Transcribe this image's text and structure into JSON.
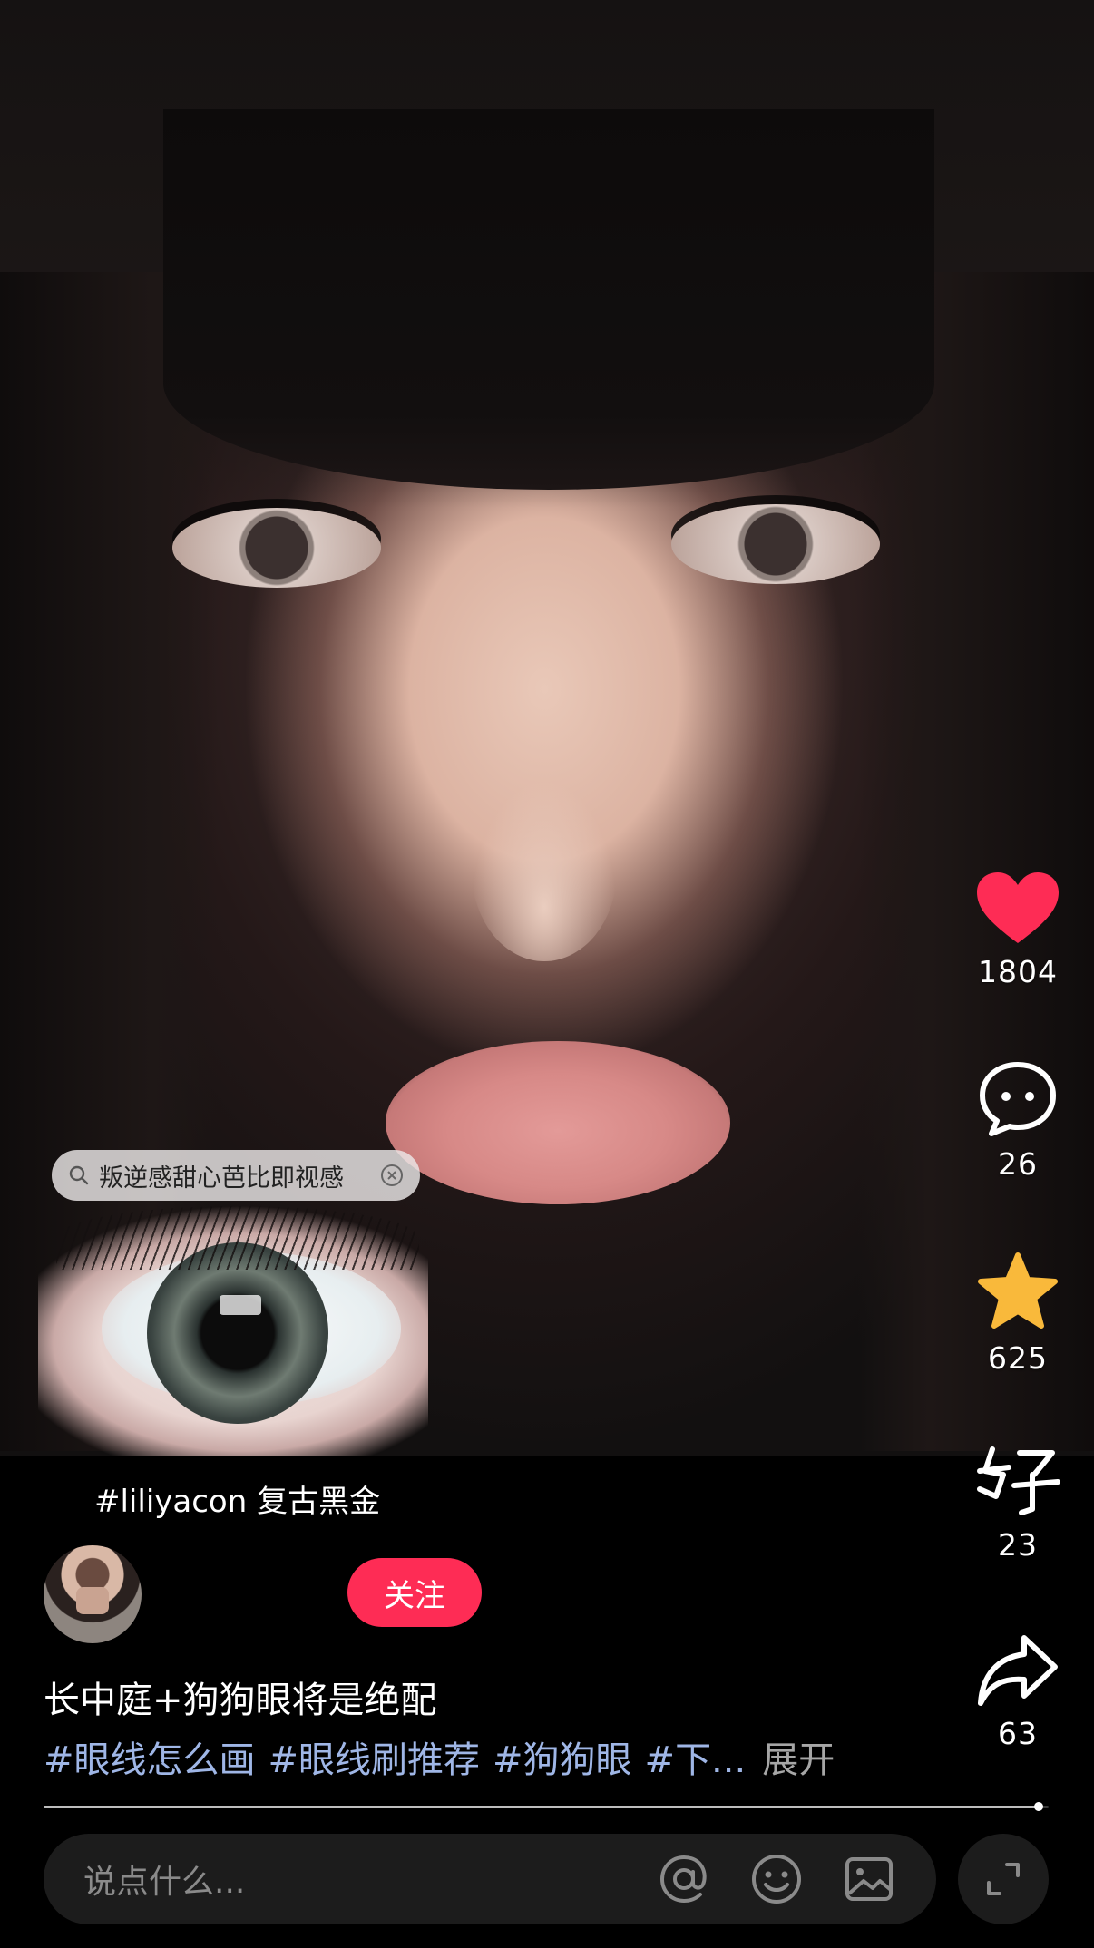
{
  "search_chip": {
    "text": "叛逆感甜心芭比即视感"
  },
  "actions": {
    "like": {
      "count": "1804",
      "color": "#fe2c55"
    },
    "comment": {
      "count": "26"
    },
    "favorite": {
      "count": "625",
      "color": "#f9b93b"
    },
    "good": {
      "count": "23"
    },
    "share": {
      "count": "63"
    }
  },
  "product_tag": "#liliyacon 复古黑金",
  "follow_label": "关注",
  "post": {
    "title": "长中庭+狗狗眼将是绝配",
    "hashtags": [
      "#眼线怎么画",
      "#眼线刷推荐",
      "#狗狗眼",
      "#下..."
    ],
    "expand_label": "展开"
  },
  "progress": 0.99,
  "comment_bar": {
    "placeholder": "说点什么..."
  },
  "icons": [
    "search-icon",
    "clear-icon",
    "heart-icon",
    "comment-icon",
    "star-icon",
    "good-icon",
    "share-icon",
    "at-icon",
    "emoji-icon",
    "image-icon",
    "fullscreen-icon"
  ]
}
